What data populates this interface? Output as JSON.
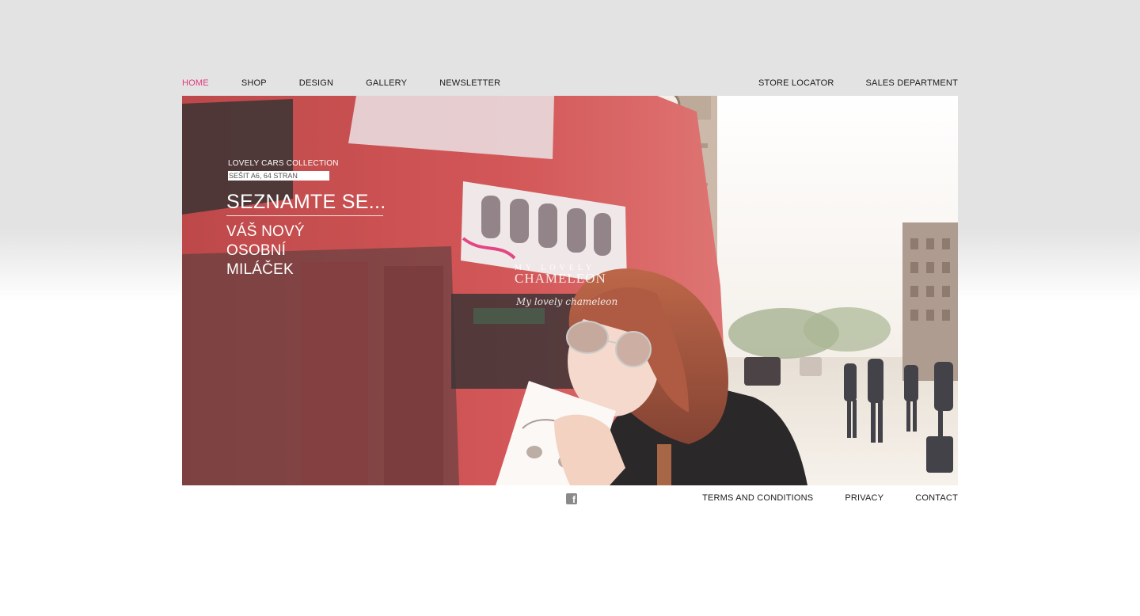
{
  "nav": {
    "left": [
      {
        "label": "HOME",
        "active": true
      },
      {
        "label": "SHOP",
        "active": false
      },
      {
        "label": "DESIGN",
        "active": false
      },
      {
        "label": "GALLERY",
        "active": false
      },
      {
        "label": "NEWSLETTER",
        "active": false
      }
    ],
    "right": [
      {
        "label": "STORE LOCATOR"
      },
      {
        "label": "SALES DEPARTMENT"
      }
    ]
  },
  "hero": {
    "collection": "LOVELY CARS COLLECTION",
    "subtitle": "SEŠIT A6, 64 STRAN",
    "headline": "SEZNAMTE SE...",
    "tagline_lines": [
      "VÁŠ NOVÝ",
      "OSOBNÍ",
      "MILÁČEK"
    ],
    "brand_small": "MY LOVELY",
    "brand_main": "CHAMELEON",
    "brand_signature": "My lovely chameleon"
  },
  "footer": {
    "social_icon": "facebook-icon",
    "links": [
      {
        "label": "TERMS AND CONDITIONS"
      },
      {
        "label": "PRIVACY"
      },
      {
        "label": "CONTACT"
      }
    ]
  },
  "colors": {
    "accent": "#e0387a",
    "text": "#1a1a1a",
    "background_top": "#e3e3e3",
    "background_bottom": "#ffffff",
    "bus_red": "#c23a3c"
  }
}
